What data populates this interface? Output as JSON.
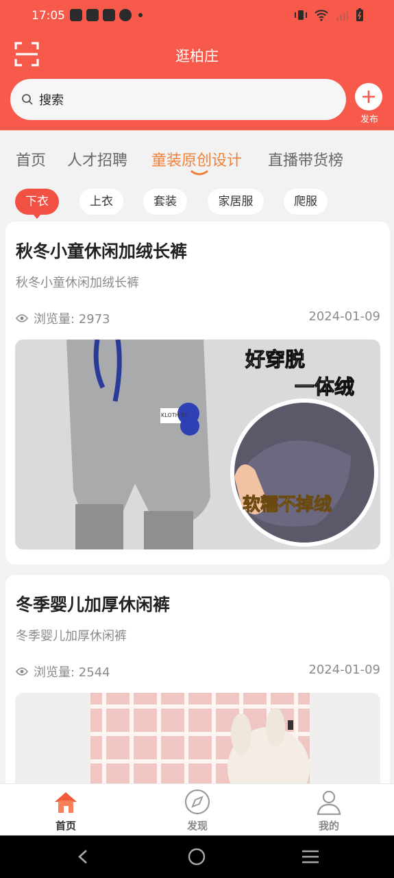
{
  "status_bar": {
    "time": "17:05"
  },
  "header": {
    "title": "逛柏庄",
    "scan_icon": "scan-icon",
    "publish_label": "发布"
  },
  "search": {
    "placeholder": "搜索"
  },
  "tabs": [
    {
      "label": "首页"
    },
    {
      "label": "人才招聘"
    },
    {
      "label": "童装原创设计",
      "active": true
    },
    {
      "label": "直播带货榜"
    }
  ],
  "chips": [
    {
      "label": "下衣",
      "active": true
    },
    {
      "label": "上衣"
    },
    {
      "label": "套装"
    },
    {
      "label": "家居服"
    },
    {
      "label": "爬服"
    }
  ],
  "cards": [
    {
      "title": "秋冬小童休闲加绒长裤",
      "subtitle": "秋冬小童休闲加绒长裤",
      "views_label": "浏览量: 2973",
      "date": "2024-01-09",
      "image_text_1": "好穿脱",
      "image_text_2": "一体绒",
      "image_text_3": "软糯不掉绒",
      "image_tag": "KLOTH ST"
    },
    {
      "title": "冬季婴儿加厚休闲裤",
      "subtitle": "冬季婴儿加厚休闲裤",
      "views_label": "浏览量: 2544",
      "date": "2024-01-09"
    }
  ],
  "bottom_nav": [
    {
      "label": "首页",
      "icon": "home-icon",
      "active": true
    },
    {
      "label": "发现",
      "icon": "compass-icon"
    },
    {
      "label": "我的",
      "icon": "user-icon"
    }
  ],
  "colors": {
    "brand": "#f7594a",
    "active_tab": "#f0813b",
    "chip_active": "#f25043"
  }
}
